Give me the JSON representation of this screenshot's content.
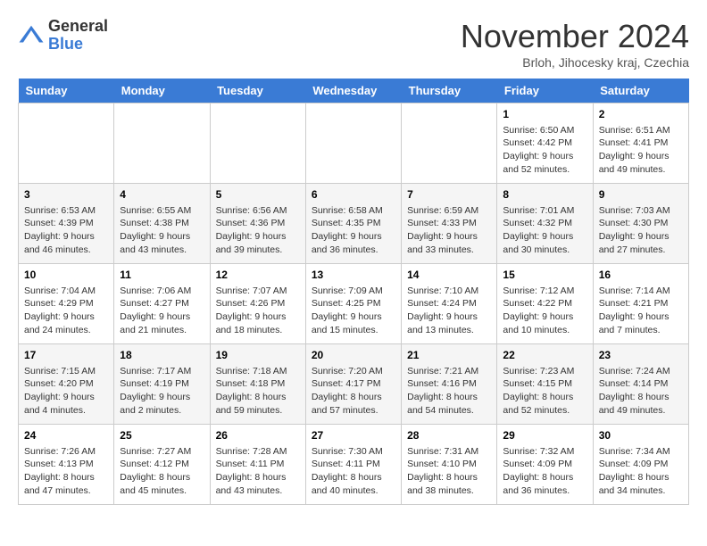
{
  "logo": {
    "general": "General",
    "blue": "Blue"
  },
  "title": "November 2024",
  "subtitle": "Brloh, Jihocesky kraj, Czechia",
  "days_of_week": [
    "Sunday",
    "Monday",
    "Tuesday",
    "Wednesday",
    "Thursday",
    "Friday",
    "Saturday"
  ],
  "weeks": [
    [
      {
        "day": "",
        "info": ""
      },
      {
        "day": "",
        "info": ""
      },
      {
        "day": "",
        "info": ""
      },
      {
        "day": "",
        "info": ""
      },
      {
        "day": "",
        "info": ""
      },
      {
        "day": "1",
        "info": "Sunrise: 6:50 AM\nSunset: 4:42 PM\nDaylight: 9 hours and 52 minutes."
      },
      {
        "day": "2",
        "info": "Sunrise: 6:51 AM\nSunset: 4:41 PM\nDaylight: 9 hours and 49 minutes."
      }
    ],
    [
      {
        "day": "3",
        "info": "Sunrise: 6:53 AM\nSunset: 4:39 PM\nDaylight: 9 hours and 46 minutes."
      },
      {
        "day": "4",
        "info": "Sunrise: 6:55 AM\nSunset: 4:38 PM\nDaylight: 9 hours and 43 minutes."
      },
      {
        "day": "5",
        "info": "Sunrise: 6:56 AM\nSunset: 4:36 PM\nDaylight: 9 hours and 39 minutes."
      },
      {
        "day": "6",
        "info": "Sunrise: 6:58 AM\nSunset: 4:35 PM\nDaylight: 9 hours and 36 minutes."
      },
      {
        "day": "7",
        "info": "Sunrise: 6:59 AM\nSunset: 4:33 PM\nDaylight: 9 hours and 33 minutes."
      },
      {
        "day": "8",
        "info": "Sunrise: 7:01 AM\nSunset: 4:32 PM\nDaylight: 9 hours and 30 minutes."
      },
      {
        "day": "9",
        "info": "Sunrise: 7:03 AM\nSunset: 4:30 PM\nDaylight: 9 hours and 27 minutes."
      }
    ],
    [
      {
        "day": "10",
        "info": "Sunrise: 7:04 AM\nSunset: 4:29 PM\nDaylight: 9 hours and 24 minutes."
      },
      {
        "day": "11",
        "info": "Sunrise: 7:06 AM\nSunset: 4:27 PM\nDaylight: 9 hours and 21 minutes."
      },
      {
        "day": "12",
        "info": "Sunrise: 7:07 AM\nSunset: 4:26 PM\nDaylight: 9 hours and 18 minutes."
      },
      {
        "day": "13",
        "info": "Sunrise: 7:09 AM\nSunset: 4:25 PM\nDaylight: 9 hours and 15 minutes."
      },
      {
        "day": "14",
        "info": "Sunrise: 7:10 AM\nSunset: 4:24 PM\nDaylight: 9 hours and 13 minutes."
      },
      {
        "day": "15",
        "info": "Sunrise: 7:12 AM\nSunset: 4:22 PM\nDaylight: 9 hours and 10 minutes."
      },
      {
        "day": "16",
        "info": "Sunrise: 7:14 AM\nSunset: 4:21 PM\nDaylight: 9 hours and 7 minutes."
      }
    ],
    [
      {
        "day": "17",
        "info": "Sunrise: 7:15 AM\nSunset: 4:20 PM\nDaylight: 9 hours and 4 minutes."
      },
      {
        "day": "18",
        "info": "Sunrise: 7:17 AM\nSunset: 4:19 PM\nDaylight: 9 hours and 2 minutes."
      },
      {
        "day": "19",
        "info": "Sunrise: 7:18 AM\nSunset: 4:18 PM\nDaylight: 8 hours and 59 minutes."
      },
      {
        "day": "20",
        "info": "Sunrise: 7:20 AM\nSunset: 4:17 PM\nDaylight: 8 hours and 57 minutes."
      },
      {
        "day": "21",
        "info": "Sunrise: 7:21 AM\nSunset: 4:16 PM\nDaylight: 8 hours and 54 minutes."
      },
      {
        "day": "22",
        "info": "Sunrise: 7:23 AM\nSunset: 4:15 PM\nDaylight: 8 hours and 52 minutes."
      },
      {
        "day": "23",
        "info": "Sunrise: 7:24 AM\nSunset: 4:14 PM\nDaylight: 8 hours and 49 minutes."
      }
    ],
    [
      {
        "day": "24",
        "info": "Sunrise: 7:26 AM\nSunset: 4:13 PM\nDaylight: 8 hours and 47 minutes."
      },
      {
        "day": "25",
        "info": "Sunrise: 7:27 AM\nSunset: 4:12 PM\nDaylight: 8 hours and 45 minutes."
      },
      {
        "day": "26",
        "info": "Sunrise: 7:28 AM\nSunset: 4:11 PM\nDaylight: 8 hours and 43 minutes."
      },
      {
        "day": "27",
        "info": "Sunrise: 7:30 AM\nSunset: 4:11 PM\nDaylight: 8 hours and 40 minutes."
      },
      {
        "day": "28",
        "info": "Sunrise: 7:31 AM\nSunset: 4:10 PM\nDaylight: 8 hours and 38 minutes."
      },
      {
        "day": "29",
        "info": "Sunrise: 7:32 AM\nSunset: 4:09 PM\nDaylight: 8 hours and 36 minutes."
      },
      {
        "day": "30",
        "info": "Sunrise: 7:34 AM\nSunset: 4:09 PM\nDaylight: 8 hours and 34 minutes."
      }
    ]
  ]
}
